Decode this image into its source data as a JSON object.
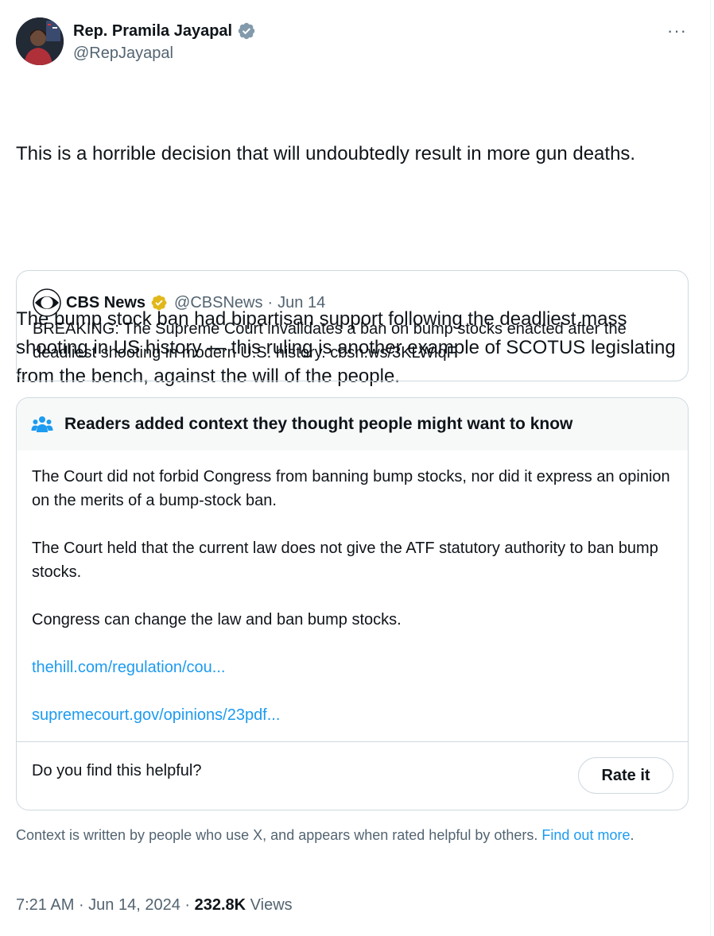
{
  "author": {
    "name": "Rep. Pramila Jayapal",
    "handle": "@RepJayapal",
    "verified_color": "#829aab"
  },
  "more_icon": "more-dots-icon",
  "more_label": "···",
  "tweet": {
    "paragraphs": [
      "This is a horrible decision that will undoubtedly result in more gun deaths.",
      "The bump stock ban had bipartisan support following the deadliest mass shooting in US history — this ruling is another example of SCOTUS legislating from the bench, against the will of the people."
    ]
  },
  "quote": {
    "name": "CBS News",
    "handle": "@CBSNews",
    "separator": "·",
    "date": "Jun 14",
    "badge_color": "#e2b719",
    "text": "BREAKING: The Supreme Court invalidates a ban on bump stocks enacted after the deadliest shooting in modern U.S. history.  cbsn.ws/3KLWiqF"
  },
  "community_note": {
    "title": "Readers added context they thought people might want to know",
    "paragraphs": [
      "The Court did not forbid Congress from banning bump stocks, nor did it express an opinion on the merits of a bump-stock ban.",
      "The Court held that the current law does not give the ATF statutory authority to ban bump stocks.",
      "Congress can change the law and ban bump stocks."
    ],
    "links": [
      "thehill.com/regulation/cou...",
      "supremecourt.gov/opinions/23pdf..."
    ],
    "helpful_question": "Do you find this helpful?",
    "rate_button": "Rate it",
    "icon_color": "#1d9bf0"
  },
  "context_footer": {
    "text": "Context is written by people who use X, and appears when rated helpful by others. ",
    "link": "Find out more",
    "suffix": "."
  },
  "meta": {
    "time": "7:21 AM",
    "sep1": " · ",
    "date": "Jun 14, 2024",
    "sep2": " · ",
    "views_count": "232.8K",
    "views_label": " Views"
  }
}
